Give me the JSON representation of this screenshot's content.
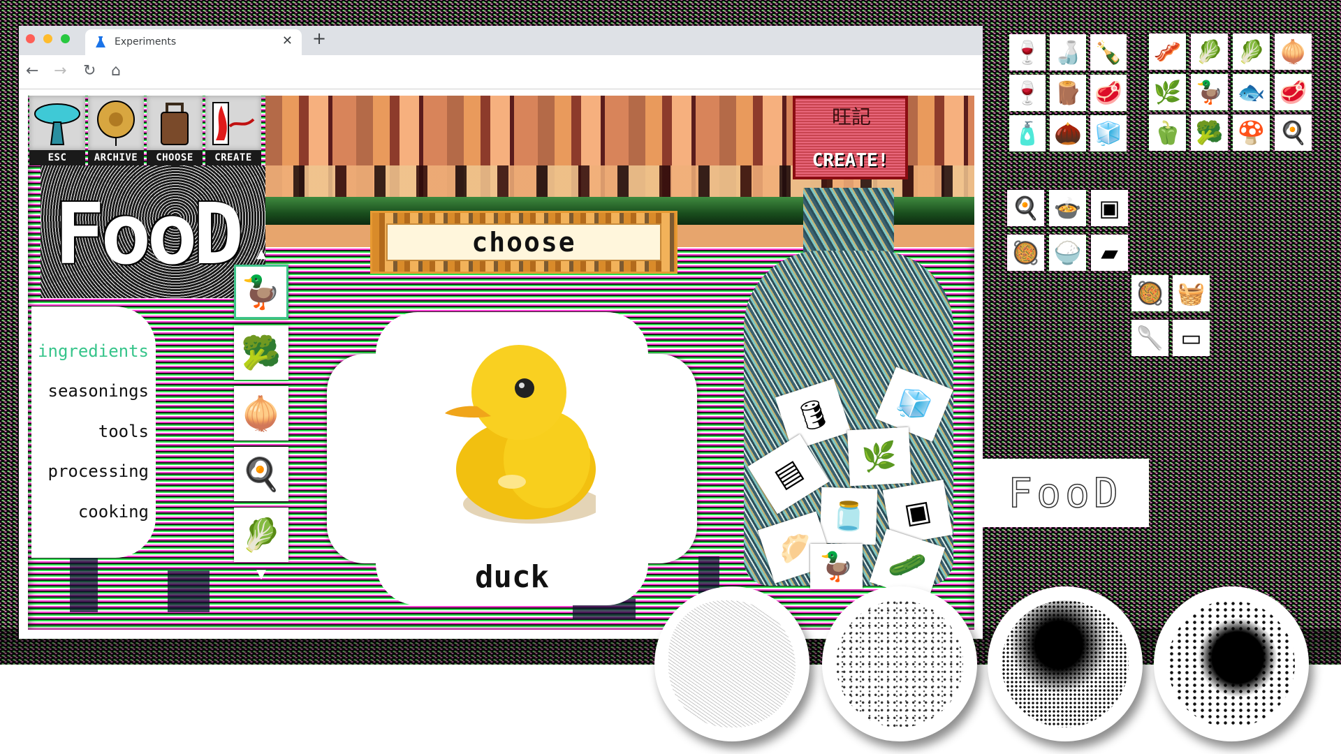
{
  "browser": {
    "tab_title": "Experiments",
    "tab_icon": "flask-icon",
    "close_label": "✕",
    "new_tab_label": "+",
    "nav": {
      "back": "←",
      "forward": "→",
      "reload": "↻",
      "home": "⌂"
    }
  },
  "app": {
    "menu": [
      {
        "id": "esc",
        "label": "ESC",
        "icon": "mushroom-lamp-icon"
      },
      {
        "id": "archive",
        "label": "ARCHIVE",
        "icon": "gold-medallion-icon"
      },
      {
        "id": "choose",
        "label": "CHOOSE",
        "icon": "bronze-bell-icon"
      },
      {
        "id": "create",
        "label": "CREATE",
        "icon": "red-flame-icon"
      }
    ],
    "logo_text": "FooD",
    "create_button": {
      "label": "CREATE!",
      "seal_text": "旺記"
    },
    "choose_title": "choose",
    "categories": [
      {
        "label": "ingredients",
        "active": true
      },
      {
        "label": "seasonings",
        "active": false
      },
      {
        "label": "tools",
        "active": false
      },
      {
        "label": "processing",
        "active": false
      },
      {
        "label": "cooking",
        "active": false
      }
    ],
    "thumbnails": [
      {
        "name": "duck",
        "glyph": "🦆",
        "selected": true
      },
      {
        "name": "broccoli",
        "glyph": "🥦",
        "selected": false
      },
      {
        "name": "onion",
        "glyph": "🧅",
        "selected": false
      },
      {
        "name": "fried-egg",
        "glyph": "🍳",
        "selected": false
      },
      {
        "name": "bok-choy",
        "glyph": "🥬",
        "selected": false
      }
    ],
    "scroll_up": "▲",
    "scroll_down": "▼",
    "selected_item_label": "duck",
    "bottle_items": [
      {
        "name": "cooking-oil",
        "glyph": "🛢"
      },
      {
        "name": "sugar-cubes",
        "glyph": "🧊"
      },
      {
        "name": "grater",
        "glyph": "▤"
      },
      {
        "name": "scallion",
        "glyph": "🌿"
      },
      {
        "name": "sauce-jar",
        "glyph": "🫙"
      },
      {
        "name": "oven",
        "glyph": "▣"
      },
      {
        "name": "dumpling-wrapper",
        "glyph": "🥟"
      },
      {
        "name": "duck",
        "glyph": "🦆"
      },
      {
        "name": "cucumber",
        "glyph": "🥒"
      }
    ]
  },
  "side_panels": {
    "seasonings": [
      {
        "name": "dark-vinegar-bottle",
        "glyph": "🍷"
      },
      {
        "name": "rice-wine-bottle",
        "glyph": "🍶"
      },
      {
        "name": "soy-sauce-bottle",
        "glyph": "🍾"
      },
      {
        "name": "cooking-wine-bottle",
        "glyph": "🍷"
      },
      {
        "name": "cinnamon-sticks",
        "glyph": "🪵"
      },
      {
        "name": "minced-meat-bowl",
        "glyph": "🥩"
      },
      {
        "name": "sesame-oil-bottle",
        "glyph": "🧴"
      },
      {
        "name": "cloves",
        "glyph": "🌰"
      },
      {
        "name": "sugar-cubes",
        "glyph": "🧊"
      }
    ],
    "ingredients": [
      {
        "name": "pork-belly",
        "glyph": "🥓"
      },
      {
        "name": "lettuce",
        "glyph": "🥬"
      },
      {
        "name": "bok-choy",
        "glyph": "🥬"
      },
      {
        "name": "onion",
        "glyph": "🧅"
      },
      {
        "name": "celery",
        "glyph": "🌿"
      },
      {
        "name": "duck",
        "glyph": "🦆"
      },
      {
        "name": "fish",
        "glyph": "🐟"
      },
      {
        "name": "beef",
        "glyph": "🥩"
      },
      {
        "name": "red-pepper",
        "glyph": "🫑"
      },
      {
        "name": "broccoli",
        "glyph": "🥦"
      },
      {
        "name": "mushroom",
        "glyph": "🍄"
      },
      {
        "name": "fried-egg",
        "glyph": "🍳"
      }
    ],
    "tools": [
      {
        "name": "wok",
        "glyph": "🍳"
      },
      {
        "name": "clay-pot",
        "glyph": "🍲"
      },
      {
        "name": "oven",
        "glyph": "▣"
      },
      {
        "name": "pressure-cooker",
        "glyph": "🥘"
      },
      {
        "name": "rice-cooker",
        "glyph": "🍚"
      },
      {
        "name": "grill-pan",
        "glyph": "▰"
      }
    ],
    "tools_extra": [
      {
        "name": "saucepan",
        "glyph": "🥘"
      },
      {
        "name": "bamboo-steamer",
        "glyph": "🧺"
      },
      {
        "name": "skimmer-ladle",
        "glyph": "🥄"
      },
      {
        "name": "microwave",
        "glyph": "▭"
      }
    ],
    "logo_sketch_text": "FooD",
    "texture_samples": [
      "texture-sample-1",
      "texture-sample-2",
      "texture-sample-3",
      "texture-sample-4"
    ]
  },
  "colors": {
    "accent_green": "#36c48a",
    "create_red": "#c8434f",
    "tab_icon_blue": "#1a73e8"
  }
}
